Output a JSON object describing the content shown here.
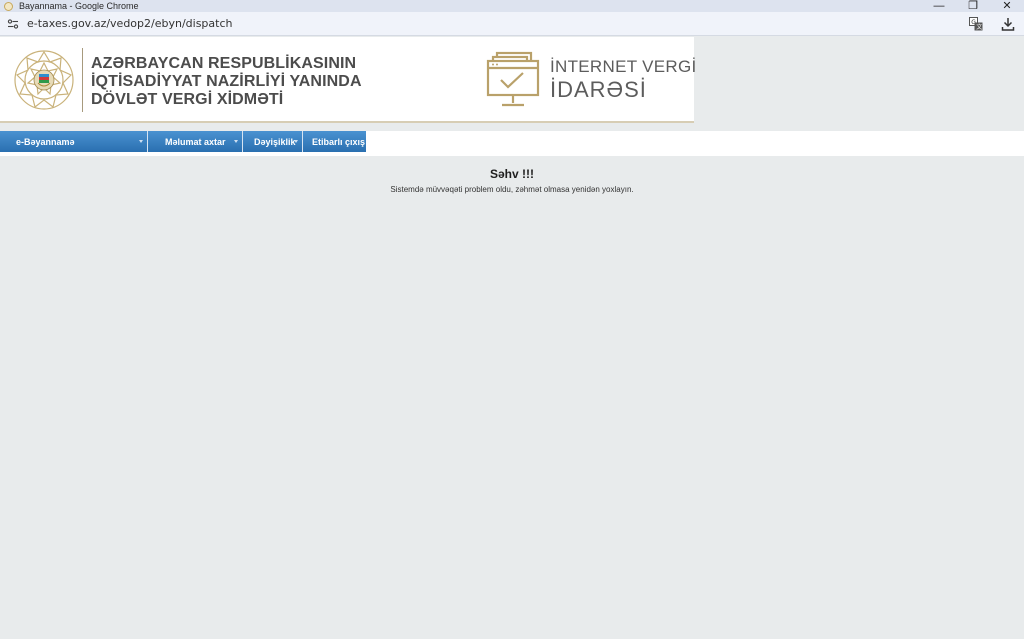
{
  "browser": {
    "window_title": "Bayannama - Google Chrome",
    "url": "e-taxes.gov.az/vedop2/ebyn/dispatch",
    "controls": {
      "minimize": "—",
      "restore": "❐",
      "close": "✕"
    }
  },
  "header": {
    "org_lines": [
      "AZƏRBAYCAN RESPUBLİKASININ",
      "İQTİSADİYYAT NAZİRLİYİ YANINDA",
      "DÖVLƏT VERGİ XİDMƏTİ"
    ],
    "portal_lines": [
      "İNTERNET VERGİ",
      "İDARƏSİ"
    ]
  },
  "menu": {
    "items": [
      {
        "label": "e-Bəyannamə"
      },
      {
        "label": "Məlumat axtar"
      },
      {
        "label": "Dəyişiklik"
      },
      {
        "label": "Etibarlı çıxış"
      }
    ]
  },
  "error": {
    "title": "Səhv !!!",
    "message": "Sistemdə müvvəqəti problem oldu, zəhmət olmasa yenidən yoxlayın."
  },
  "colors": {
    "menu_blue": "#2a6fb0",
    "gold": "#b9a16a",
    "page_bg": "#e8ebec"
  }
}
